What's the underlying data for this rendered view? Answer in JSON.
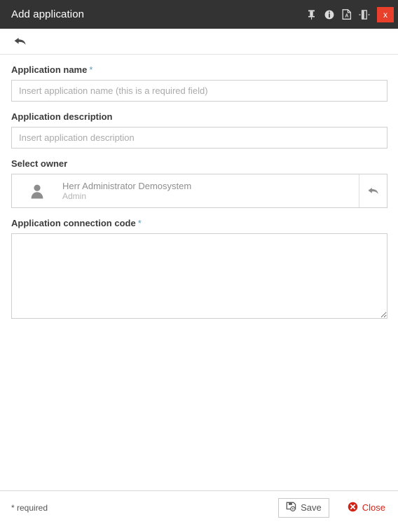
{
  "window": {
    "title": "Add application",
    "title_bar_bg": "#333333",
    "close_bg": "#e8402a",
    "required_star_color": "#5b9dbb",
    "actions": [
      {
        "name": "pin-icon",
        "label": "Pin"
      },
      {
        "name": "info-icon",
        "label": "Info"
      },
      {
        "name": "pdf-export-icon",
        "label": "Export PDF"
      },
      {
        "name": "dock-panel-icon",
        "label": "Toggle panel"
      }
    ],
    "close_label": "x"
  },
  "toolbar": {
    "back_label": "Back"
  },
  "form": {
    "fields": [
      {
        "label": "Application name",
        "required": true,
        "star": "*",
        "placeholder": "Insert application name (this is a required field)",
        "value": ""
      },
      {
        "label": "Application description",
        "required": false,
        "star": "",
        "placeholder": "Insert application description",
        "value": ""
      }
    ],
    "owner": {
      "label": "Select owner",
      "required": false,
      "star": "",
      "name": "Herr Administrator Demosystem",
      "role": "Admin",
      "reset_label": "Reset owner"
    },
    "connection_code": {
      "label": "Application connection code",
      "required": true,
      "star": "*",
      "placeholder": "",
      "value": ""
    }
  },
  "footer": {
    "note": "* required",
    "save_label": "Save",
    "close_label": "Close",
    "close_color": "#d32316"
  }
}
